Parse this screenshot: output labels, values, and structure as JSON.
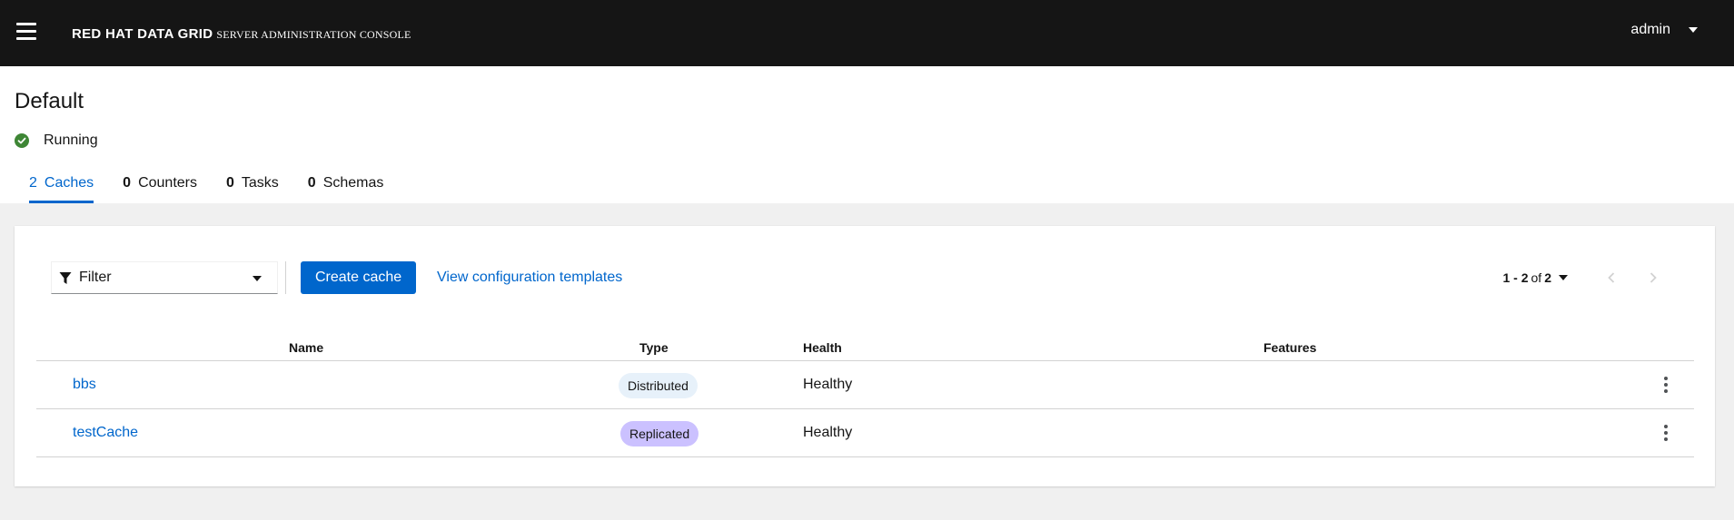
{
  "masthead": {
    "brand_main": "RED HAT DATA GRID",
    "brand_sub": "SERVER ADMINISTRATION CONSOLE",
    "user": "admin"
  },
  "page": {
    "title": "Default",
    "status": "Running",
    "status_color": "#3e8635"
  },
  "tabs": [
    {
      "count": "2",
      "label": "Caches",
      "active": true
    },
    {
      "count": "0",
      "label": "Counters",
      "active": false
    },
    {
      "count": "0",
      "label": "Tasks",
      "active": false
    },
    {
      "count": "0",
      "label": "Schemas",
      "active": false
    }
  ],
  "toolbar": {
    "filter_label": "Filter",
    "create_label": "Create cache",
    "templates_label": "View configuration templates"
  },
  "pagination": {
    "range": "1 - 2",
    "of": "of",
    "total": "2"
  },
  "table": {
    "headers": {
      "name": "Name",
      "type": "Type",
      "health": "Health",
      "features": "Features"
    },
    "rows": [
      {
        "name": "bbs",
        "type": "Distributed",
        "health": "Healthy"
      },
      {
        "name": "testCache",
        "type": "Replicated",
        "health": "Healthy"
      }
    ]
  },
  "colors": {
    "accent": "#0066cc",
    "masthead_bg": "#151515",
    "distributed_badge": "#e7f1fa",
    "replicated_badge": "#cbc1ff"
  }
}
